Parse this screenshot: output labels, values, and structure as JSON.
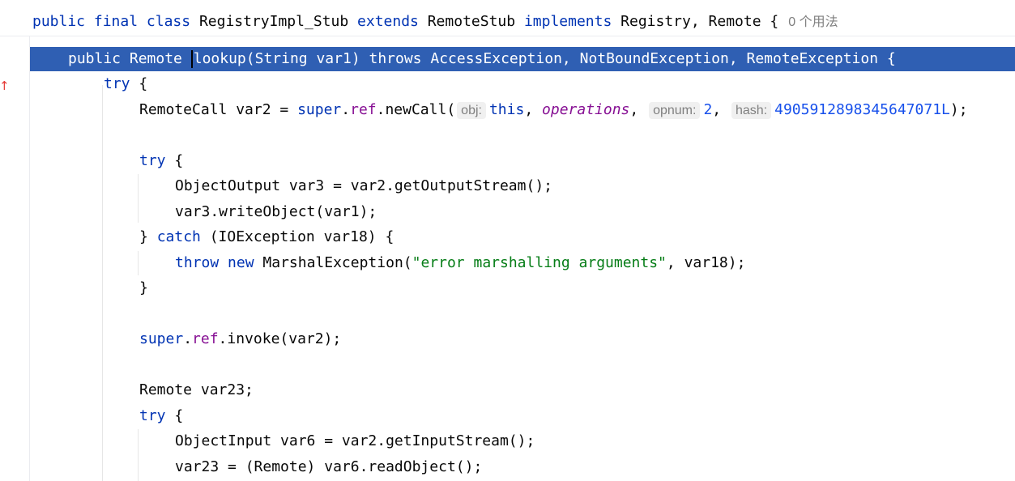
{
  "header": {
    "parts": [
      "public",
      "final",
      "class",
      "RegistryImpl_Stub",
      "extends",
      "RemoteStub",
      "implements",
      "Registry, Remote {"
    ],
    "usage_hint": "0 个用法"
  },
  "gutter": {
    "marker": "↑"
  },
  "code": {
    "l1": [
      "public",
      "Remote",
      "lookup(String var1)",
      "throws",
      "AccessException, NotBoundException, RemoteException {"
    ],
    "l2": [
      "try",
      " {"
    ],
    "l3": [
      "RemoteCall var2 = ",
      "super",
      ".",
      "ref",
      ".newCall(",
      "obj:",
      "this",
      ", ",
      "operations",
      ", ",
      "opnum:",
      "2",
      ", ",
      "hash:",
      "4905912898345647071L",
      ");"
    ],
    "l5": [
      "try",
      " {"
    ],
    "l6": "ObjectOutput var3 = var2.getOutputStream();",
    "l7": "var3.writeObject(var1);",
    "l8": [
      "} ",
      "catch",
      " (IOException var18) {"
    ],
    "l9": [
      "throw",
      "new",
      "MarshalException(",
      "\"error marshalling arguments\"",
      ", var18);"
    ],
    "l10": "}",
    "l12": [
      "super",
      ".",
      "ref",
      ".invoke(var2);"
    ],
    "l14": "Remote var23;",
    "l15": [
      "try",
      " {"
    ],
    "l16": "ObjectInput var6 = var2.getInputStream();",
    "l17": "var23 = (Remote) var6.readObject();"
  }
}
